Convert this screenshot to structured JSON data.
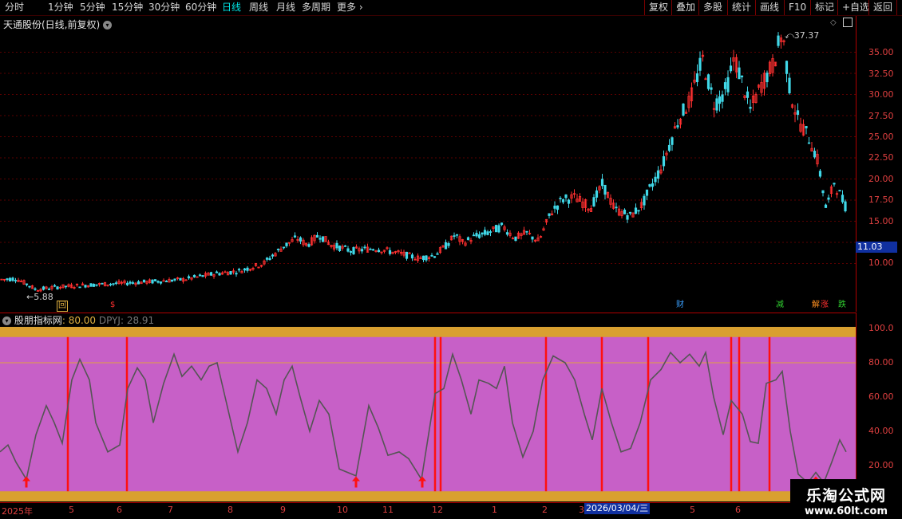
{
  "toolbar": {
    "periods": [
      "分时",
      "1分钟",
      "5分钟",
      "15分钟",
      "30分钟",
      "60分钟",
      "日线",
      "周线",
      "月线",
      "多周期",
      "更多"
    ],
    "active_period": "日线",
    "more_arrow": "›",
    "right_buttons": [
      "复权",
      "叠加",
      "多股",
      "统计",
      "画线",
      "F10",
      "标记",
      "+自选",
      "返回"
    ]
  },
  "main_chart": {
    "title": "天通股份(日线,前复权)",
    "price_labels": [
      "35.00",
      "32.50",
      "30.00",
      "27.50",
      "25.00",
      "22.50",
      "20.00",
      "17.50",
      "15.00",
      "10.00"
    ],
    "current_price": "11.03",
    "high_label": "37.37",
    "low_label": "5.88",
    "event_markers": [
      {
        "text": "回",
        "color": "#e0b040"
      },
      {
        "text": "$",
        "color": "#ff3030"
      },
      {
        "text": "财",
        "color": "#3aa0ff"
      },
      {
        "text": "减",
        "color": "#30d030"
      },
      {
        "text": "解",
        "color": "#ff9020"
      },
      {
        "text": "涨",
        "color": "#ff3030"
      },
      {
        "text": "跌",
        "color": "#30d030"
      }
    ]
  },
  "indicator": {
    "name": "股朋指标网",
    "value_text": ": 80.00",
    "dpyj_text": "DPYJ: 28.91",
    "axis_labels": [
      "100.0",
      "80.00",
      "60.00",
      "40.00",
      "20.00"
    ]
  },
  "x_axis": {
    "labels": [
      "2025年",
      "5",
      "6",
      "7",
      "8",
      "9",
      "10",
      "11",
      "12",
      "1",
      "2",
      "3",
      "5",
      "6"
    ],
    "cursor_date": "2026/03/04/三"
  },
  "watermark": {
    "title": "乐淘公式网",
    "url": "www.60lt.com"
  },
  "colors": {
    "bg": "#000000",
    "up": "#ff3030",
    "down": "#40d8e8",
    "indicator_fill": "#c760c7",
    "indicator_band": "#d9a030",
    "signal_line": "#ff1010",
    "curve": "#555555",
    "axis_text": "#e04040"
  }
}
